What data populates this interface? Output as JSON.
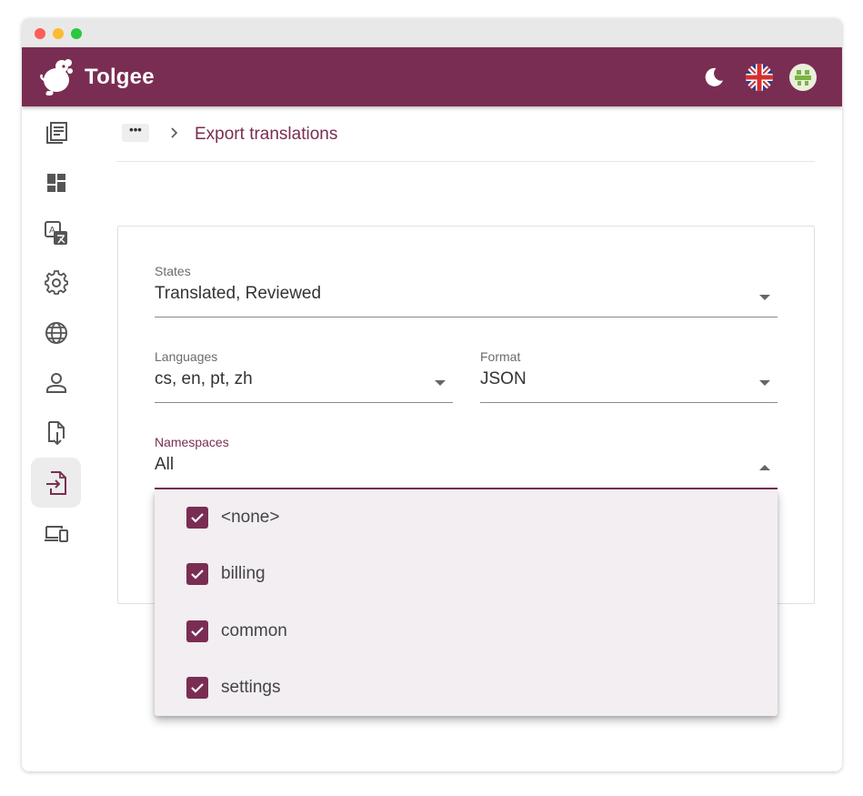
{
  "app": {
    "name": "Tolgee"
  },
  "header": {
    "theme_toggle_icon": "moon-icon",
    "language_icon": "uk-flag-icon",
    "avatar_icon": "user-avatar-icon",
    "brand_color": "#7a2d52"
  },
  "sidebar": {
    "items": [
      {
        "name": "projects",
        "icon": "library-books-icon",
        "active": false
      },
      {
        "name": "dashboard",
        "icon": "dashboard-icon",
        "active": false
      },
      {
        "name": "translations",
        "icon": "translate-icon",
        "active": false
      },
      {
        "name": "settings",
        "icon": "gear-icon",
        "active": false
      },
      {
        "name": "languages",
        "icon": "globe-icon",
        "active": false
      },
      {
        "name": "members",
        "icon": "person-icon",
        "active": false
      },
      {
        "name": "import",
        "icon": "file-download-icon",
        "active": false
      },
      {
        "name": "export",
        "icon": "file-export-icon",
        "active": true
      },
      {
        "name": "integrations",
        "icon": "devices-icon",
        "active": false
      }
    ]
  },
  "breadcrumb": {
    "more_label": "•••",
    "separator": "›",
    "current": "Export translations"
  },
  "form": {
    "states": {
      "label": "States",
      "value": "Translated, Reviewed"
    },
    "languages": {
      "label": "Languages",
      "value": "cs, en, pt, zh"
    },
    "format": {
      "label": "Format",
      "value": "JSON"
    },
    "namespaces": {
      "label": "Namespaces",
      "value": "All"
    }
  },
  "namespace_options": [
    {
      "label": "<none>",
      "checked": true
    },
    {
      "label": "billing",
      "checked": true
    },
    {
      "label": "common",
      "checked": true
    },
    {
      "label": "settings",
      "checked": true
    }
  ]
}
